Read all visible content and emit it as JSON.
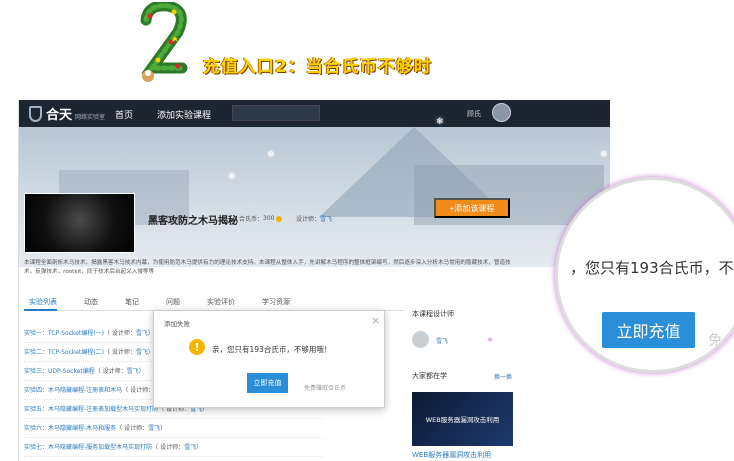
{
  "caption": "充值入口2：当合氏币不够时",
  "nav": {
    "brand": "合天",
    "brand_sub": "网络实验室",
    "home": "首页",
    "add_lab": "添加实验课程",
    "search_placeholder": "",
    "user": "顾氏"
  },
  "course": {
    "title": "黑客攻防之木马揭秘",
    "price_label": "合氏币：",
    "price_value": "300",
    "designer_label": "设计师：",
    "designer_name": "雪飞",
    "add_button": "+添加该课程",
    "description": "本课程全面剖析木马技术，揭露黑客木马技术内幕，为使用防范木马提供有力的理论技术支持。本课程从整体入手，先讲解木马程序的整体框架编写，然后逐步深入分析木马常用的隐藏技术，管道技术，反弹技术，rootkit，同于技术后台起义入侵等等"
  },
  "tabs": [
    "实验列表",
    "动态",
    "笔记",
    "问题",
    "实验评价",
    "学习资源"
  ],
  "experiments": [
    {
      "title": "实验一：TCP-Socket编程(一)",
      "designer": "雪飞"
    },
    {
      "title": "实验二：TCP-Socket编程(二)",
      "designer": "雪飞"
    },
    {
      "title": "实验三：UDP-Socket编程",
      "designer": "雪飞"
    },
    {
      "title": "实验四：木马隐藏编程-注册表和木马",
      "designer": "雪飞"
    },
    {
      "title": "实验五：木马隐藏编程-注册表加载型木马实现打防",
      "designer": "雪飞"
    },
    {
      "title": "实验六：木马隐藏编程-木马和服务",
      "designer": "雪飞"
    },
    {
      "title": "实验七：木马隐藏编程-服务加载型木马实现打防",
      "designer": "雪飞"
    }
  ],
  "designer_prefix": "（ 设计师：",
  "designer_suffix": "）",
  "sidebar": {
    "designer_heading": "本课程设计师",
    "designer_name": "雪飞",
    "learning_heading": "大家都在学",
    "more": "换一换",
    "thumb_label": "WEB服务器漏洞攻击利用",
    "thumb_caption": "WEB服务器漏洞攻击利用"
  },
  "modal": {
    "title": "添加失败",
    "message": "亲，您只有193合氏币，不够用哦！",
    "button": "立即充值",
    "link": "免费赚取合氏币"
  },
  "magnifier": {
    "text": "，您只有193合氏币，不",
    "button": "立即充值",
    "faint": "免"
  },
  "colors": {
    "accent": "#2b8ed8",
    "orange": "#f08c1c",
    "caption": "#ffd400"
  }
}
